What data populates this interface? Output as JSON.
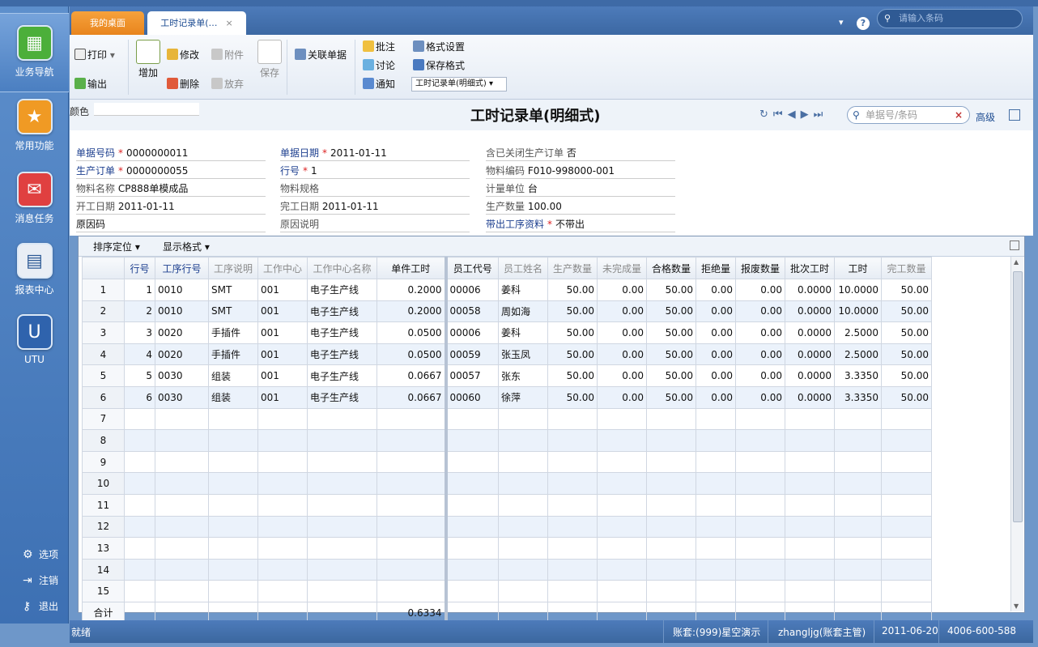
{
  "tabs": {
    "home": "我的桌面",
    "active": "工时记录单(…",
    "close": "×"
  },
  "header": {
    "search_placeholder": "请输入条码"
  },
  "leftnav": {
    "items": [
      "业务导航",
      "常用功能",
      "消息任务",
      "报表中心",
      "UTU"
    ],
    "bottom": [
      "选项",
      "注销",
      "退出"
    ]
  },
  "toolbar": {
    "print": "打印",
    "export": "输出",
    "add": "增加",
    "edit": "修改",
    "attach": "附件",
    "delete": "删除",
    "abandon": "放弃",
    "save": "保存",
    "related": "关联单据",
    "annotate": "批注",
    "discuss": "讨论",
    "notify": "通知",
    "format_settings": "格式设置",
    "save_format": "保存格式",
    "format_select": "工时记录单(明细式)"
  },
  "page": {
    "title": "工时记录单(明细式)",
    "color_label": "颜色",
    "search_placeholder": "单据号/条码",
    "advanced": "高级"
  },
  "form": {
    "doc_no_label": "单据号码",
    "doc_no": "0000000011",
    "doc_date_label": "单据日期",
    "doc_date": "2011-01-11",
    "closed_label": "含已关闭生产订单",
    "closed": "否",
    "order_label": "生产订单",
    "order": "0000000055",
    "line_label": "行号",
    "line": "1",
    "material_code_label": "物料编码",
    "material_code": "F010-998000-001",
    "material_name_label": "物料名称",
    "material_name": "CP888单模成品",
    "spec_label": "物料规格",
    "spec": "",
    "unit_label": "计量单位",
    "unit": "台",
    "start_label": "开工日期",
    "start": "2011-01-11",
    "finish_label": "完工日期",
    "finish": "2011-01-11",
    "qty_label": "生产数量",
    "qty": "100.00",
    "reason_code_label": "原因码",
    "reason_code": "",
    "reason_desc_label": "原因说明",
    "reason_desc": "",
    "bring_label": "带出工序资料",
    "bring": "不带出"
  },
  "grid": {
    "sort_label": "排序定位",
    "display_label": "显示格式",
    "columns": [
      "行号",
      "工序行号",
      "工序说明",
      "工作中心",
      "工作中心名称",
      "单件工时",
      "员工代号",
      "员工姓名",
      "生产数量",
      "未完成量",
      "合格数量",
      "拒绝量",
      "报废数量",
      "批次工时",
      "工时",
      "完工数量"
    ],
    "rows": [
      [
        "1",
        "1",
        "0010",
        "SMT",
        "001",
        "电子生产线",
        "0.2000",
        "00006",
        "姜科",
        "50.00",
        "0.00",
        "50.00",
        "0.00",
        "0.00",
        "0.0000",
        "10.0000",
        "50.00"
      ],
      [
        "2",
        "2",
        "0010",
        "SMT",
        "001",
        "电子生产线",
        "0.2000",
        "00058",
        "周如海",
        "50.00",
        "0.00",
        "50.00",
        "0.00",
        "0.00",
        "0.0000",
        "10.0000",
        "50.00"
      ],
      [
        "3",
        "3",
        "0020",
        "手插件",
        "001",
        "电子生产线",
        "0.0500",
        "00006",
        "姜科",
        "50.00",
        "0.00",
        "50.00",
        "0.00",
        "0.00",
        "0.0000",
        "2.5000",
        "50.00"
      ],
      [
        "4",
        "4",
        "0020",
        "手插件",
        "001",
        "电子生产线",
        "0.0500",
        "00059",
        "张玉凤",
        "50.00",
        "0.00",
        "50.00",
        "0.00",
        "0.00",
        "0.0000",
        "2.5000",
        "50.00"
      ],
      [
        "5",
        "5",
        "0030",
        "组装",
        "001",
        "电子生产线",
        "0.0667",
        "00057",
        "张东",
        "50.00",
        "0.00",
        "50.00",
        "0.00",
        "0.00",
        "0.0000",
        "3.3350",
        "50.00"
      ],
      [
        "6",
        "6",
        "0030",
        "组装",
        "001",
        "电子生产线",
        "0.0667",
        "00060",
        "徐萍",
        "50.00",
        "0.00",
        "50.00",
        "0.00",
        "0.00",
        "0.0000",
        "3.3350",
        "50.00"
      ],
      [
        "7",
        "",
        "",
        "",
        "",
        "",
        "",
        "",
        "",
        "",
        "",
        "",
        "",
        "",
        "",
        "",
        ""
      ],
      [
        "8",
        "",
        "",
        "",
        "",
        "",
        "",
        "",
        "",
        "",
        "",
        "",
        "",
        "",
        "",
        "",
        ""
      ],
      [
        "9",
        "",
        "",
        "",
        "",
        "",
        "",
        "",
        "",
        "",
        "",
        "",
        "",
        "",
        "",
        "",
        ""
      ],
      [
        "10",
        "",
        "",
        "",
        "",
        "",
        "",
        "",
        "",
        "",
        "",
        "",
        "",
        "",
        "",
        "",
        ""
      ],
      [
        "11",
        "",
        "",
        "",
        "",
        "",
        "",
        "",
        "",
        "",
        "",
        "",
        "",
        "",
        "",
        "",
        ""
      ],
      [
        "12",
        "",
        "",
        "",
        "",
        "",
        "",
        "",
        "",
        "",
        "",
        "",
        "",
        "",
        "",
        "",
        ""
      ],
      [
        "13",
        "",
        "",
        "",
        "",
        "",
        "",
        "",
        "",
        "",
        "",
        "",
        "",
        "",
        "",
        "",
        ""
      ],
      [
        "14",
        "",
        "",
        "",
        "",
        "",
        "",
        "",
        "",
        "",
        "",
        "",
        "",
        "",
        "",
        "",
        ""
      ],
      [
        "15",
        "",
        "",
        "",
        "",
        "",
        "",
        "",
        "",
        "",
        "",
        "",
        "",
        "",
        "",
        "",
        ""
      ]
    ],
    "total_label": "合计",
    "total_unit_hours": "0.6334"
  },
  "status": {
    "ready": "就绪",
    "account": "账套:(999)星空演示",
    "user": "zhangljg(账套主管)",
    "date": "2011-06-20",
    "phone": "4006-600-588"
  },
  "colors": {
    "accent": "#3d70b3",
    "tab_home": "#f08d26",
    "link": "#1d3f8f",
    "required": "#dd2222"
  }
}
